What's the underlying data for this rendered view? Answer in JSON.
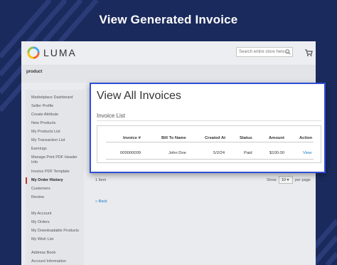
{
  "banner": {
    "title": "View Generated Invoice"
  },
  "header": {
    "logo_text": "LUMA",
    "search_placeholder": "Search entire store here..."
  },
  "breadcrumb": {
    "product": "product"
  },
  "sidebar": {
    "items": [
      {
        "label": "Marketplace Dashboard"
      },
      {
        "label": "Seller Profile"
      },
      {
        "label": "Create Attribute"
      },
      {
        "label": "New Products"
      },
      {
        "label": "My Products List"
      },
      {
        "label": "My Transaction List"
      },
      {
        "label": "Earnings"
      },
      {
        "label": "Manage Print PDF Header Info"
      },
      {
        "label": "Invoice PDF Template"
      },
      {
        "label": "My Order History"
      },
      {
        "label": "Customers"
      },
      {
        "label": "Review"
      },
      {
        "label": "My Account"
      },
      {
        "label": "My Orders"
      },
      {
        "label": "My Downloadable Products"
      },
      {
        "label": "My Wish List"
      },
      {
        "label": "Address Book"
      },
      {
        "label": "Account Information"
      }
    ],
    "active": "My Order History"
  },
  "panel": {
    "title": "View All Invoices",
    "subtitle": "Invoice List",
    "columns": [
      "Invoice #",
      "Bill To Name",
      "Created At",
      "Status",
      "Amount",
      "Action"
    ],
    "rows": [
      {
        "invoice": "000000009",
        "bill_to": "John Doe",
        "created_at": "5/2/24",
        "status": "Paid",
        "amount": "$100.00",
        "action": "View"
      }
    ]
  },
  "pager": {
    "items_count": "1 Item",
    "show_label": "Show",
    "page_size": "10",
    "per_page_label": "per page"
  },
  "back_link": "« Back",
  "colors": {
    "background": "#1b2a5c",
    "panel_border": "#2f4fd6",
    "link": "#1979c3",
    "active_marker": "#c0392b"
  }
}
